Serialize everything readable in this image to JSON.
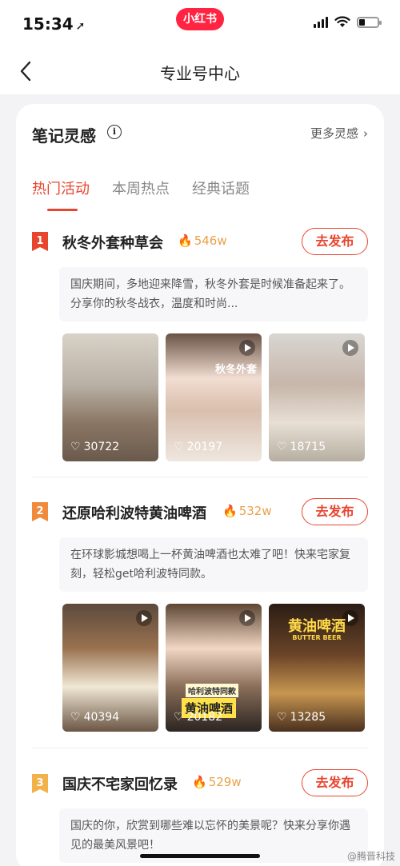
{
  "status_bar": {
    "time": "15:34",
    "location_glyph": "➚",
    "brand": "小红书"
  },
  "nav": {
    "title": "专业号中心"
  },
  "card": {
    "title": "笔记灵感",
    "info_glyph": "i",
    "more_label": "更多灵感",
    "tabs": [
      {
        "label": "热门活动",
        "active": true
      },
      {
        "label": "本周热点",
        "active": false
      },
      {
        "label": "经典话题",
        "active": false
      }
    ]
  },
  "activities": [
    {
      "rank": "1",
      "title": "秋冬外套种草会",
      "heat": "546w",
      "publish_label": "去发布",
      "desc": "国庆期间，多地迎来降雪，秋冬外套是时候准备起来了。分享你的秋冬战衣，温度和时尚...",
      "thumbs": [
        {
          "likes": "30722",
          "video": false
        },
        {
          "likes": "20197",
          "video": true,
          "overlay": "秋冬外套"
        },
        {
          "likes": "18715",
          "video": true
        }
      ]
    },
    {
      "rank": "2",
      "title": "还原哈利波特黄油啤酒",
      "heat": "532w",
      "publish_label": "去发布",
      "desc": "在环球影城想喝上一杯黄油啤酒也太难了吧！快来宅家复刻，轻松get哈利波特同款。",
      "thumbs": [
        {
          "likes": "40394",
          "video": true
        },
        {
          "likes": "20182",
          "video": true,
          "overlay_small": "哈利波特同款",
          "overlay": "黄油啤酒"
        },
        {
          "likes": "13285",
          "video": true,
          "overlay": "黄油啤酒",
          "overlay_sub": "BUTTER BEER"
        }
      ]
    },
    {
      "rank": "3",
      "title": "国庆不宅家回忆录",
      "heat": "529w",
      "publish_label": "去发布",
      "desc": "国庆的你，欣赏到哪些难以忘怀的美景呢？快来分享你遇见的最美风景吧！"
    }
  ],
  "watermark": "@腾晋科技"
}
